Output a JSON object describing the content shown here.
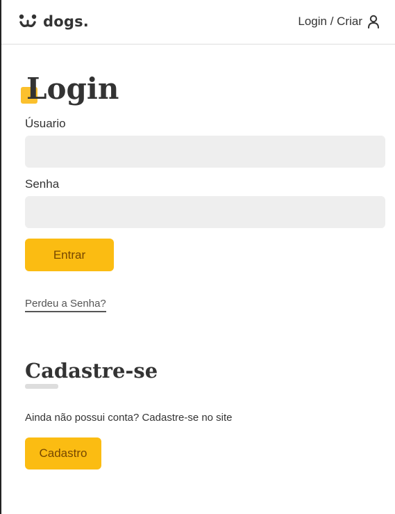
{
  "header": {
    "logo_text": "dogs.",
    "login_link": "Login / Criar"
  },
  "login": {
    "title": "Login",
    "username_label": "Úsuario",
    "username_value": "",
    "password_label": "Senha",
    "password_value": "",
    "submit_label": "Entrar",
    "lost_password_link": "Perdeu a Senha?"
  },
  "signup": {
    "title": "Cadastre-se",
    "text": "Ainda não possui conta? Cadastre-se no site",
    "button_label": "Cadastro"
  },
  "colors": {
    "accent": "#fbbc12",
    "button_text": "#764701",
    "input_bg": "#eeeeee",
    "text": "#333333"
  },
  "icons": {
    "logo": "dog-face-icon",
    "user": "user-icon"
  }
}
